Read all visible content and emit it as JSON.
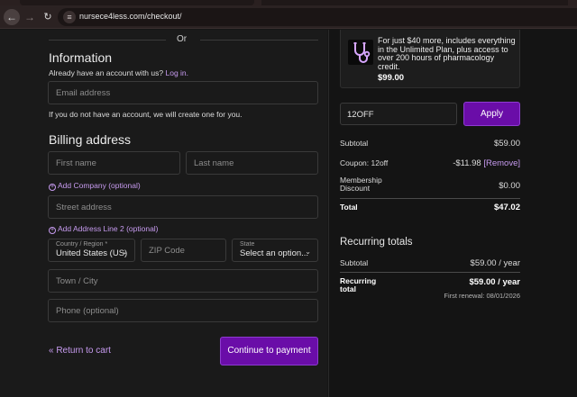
{
  "browser": {
    "url": "nursece4less.com/checkout/"
  },
  "left": {
    "or": "Or",
    "info_title": "Information",
    "have_account": "Already have an account with us?",
    "login": "Log in.",
    "email_placeholder": "Email address",
    "create_note": "If you do not have an account, we will create one for you.",
    "billing_title": "Billing address",
    "first_name_placeholder": "First name",
    "last_name_placeholder": "Last name",
    "add_company": "Add Company (optional)",
    "street_placeholder": "Street address",
    "add_line2": "Add Address Line 2 (optional)",
    "country_label": "Country / Region *",
    "country_value": "United States (US)",
    "zip_placeholder": "ZIP Code",
    "state_label": "State",
    "state_value": "Select an option...",
    "city_placeholder": "Town / City",
    "phone_placeholder": "Phone (optional)",
    "return_link": "« Return to cart",
    "continue_button": "Continue to payment"
  },
  "right": {
    "promo_text": "For just $40 more, includes everything in the Unlimited Plan, plus access to over 200 hours of pharmacology credit.",
    "promo_price": "$99.00",
    "coupon_value": "12OFF",
    "apply_button": "Apply",
    "subtotal_label": "Subtotal",
    "subtotal_value": "$59.00",
    "coupon_label": "Coupon: 12off",
    "coupon_amount": "-$11.98",
    "remove_link": "[Remove]",
    "membership_label": "Membership Discount",
    "membership_value": "$0.00",
    "total_label": "Total",
    "total_value": "$47.02",
    "recurring_title": "Recurring totals",
    "rec_subtotal_label": "Subtotal",
    "rec_subtotal_value": "$59.00 / year",
    "rec_total_label": "Recurring total",
    "rec_total_value": "$59.00 / year",
    "first_renewal": "First renewal: 08/01/2026"
  },
  "colors": {
    "accent": "#6a0da8",
    "link": "#c79bf0"
  }
}
